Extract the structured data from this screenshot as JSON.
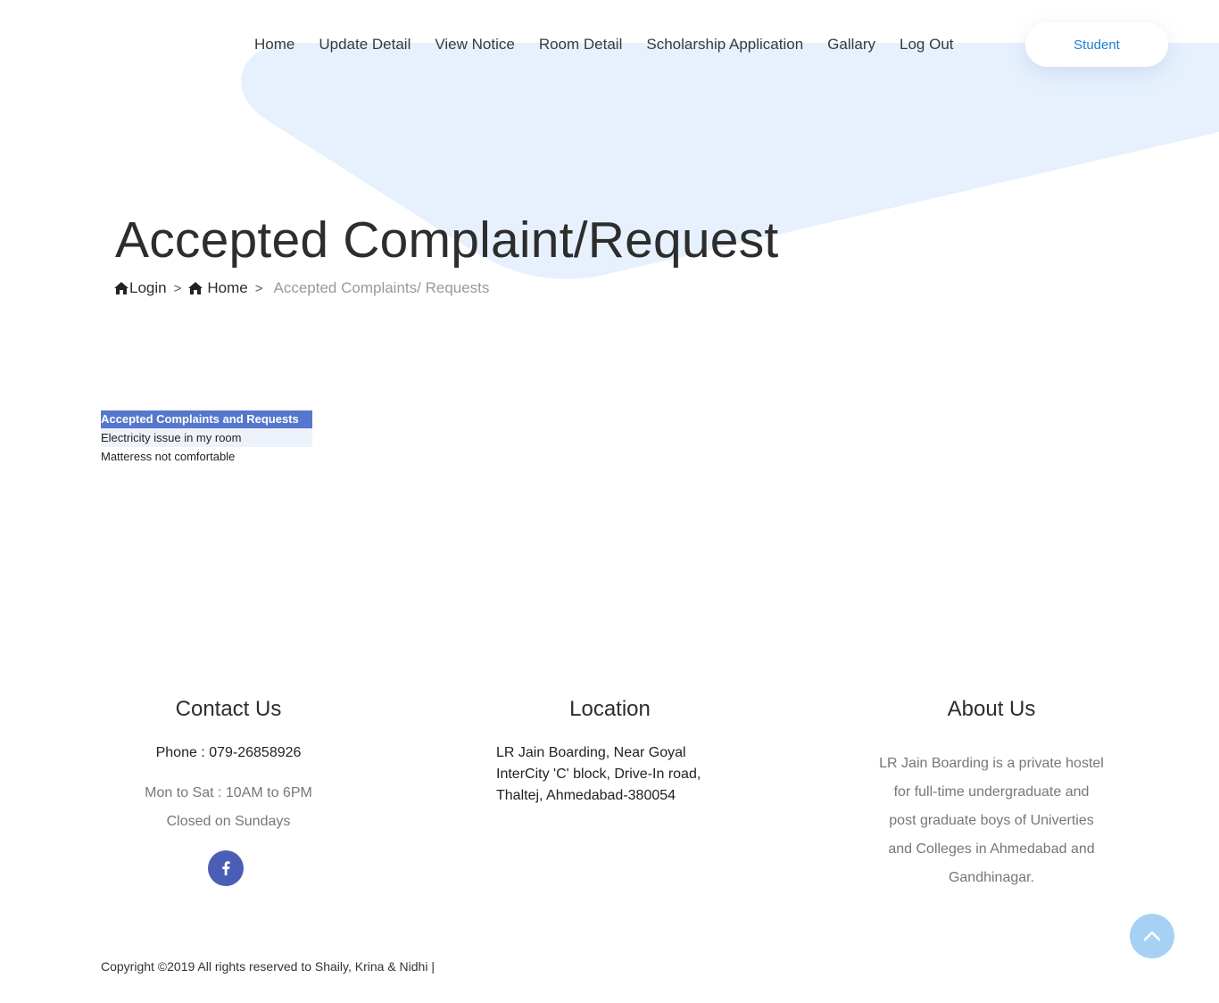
{
  "nav": {
    "items": [
      {
        "label": "Home"
      },
      {
        "label": "Update Detail"
      },
      {
        "label": "View Notice"
      },
      {
        "label": "Room Detail"
      },
      {
        "label": "Scholarship Application"
      },
      {
        "label": "Gallary"
      },
      {
        "label": "Log Out"
      }
    ],
    "student_label": "Student"
  },
  "header": {
    "title": "Accepted Complaint/Request",
    "breadcrumb": {
      "login": "Login",
      "separator": ">",
      "home": "Home",
      "current": "Accepted Complaints/ Requests"
    }
  },
  "complaints": {
    "header": "Accepted Complaints and Requests",
    "rows": [
      "Electricity issue in my room",
      "Matteress not comfortable"
    ]
  },
  "footer": {
    "contact": {
      "title": "Contact Us",
      "phone": "Phone : 079-26858926",
      "hours": "Mon to Sat : 10AM to 6PM",
      "closed": "Closed on Sundays",
      "facebook_icon": "facebook-icon"
    },
    "location": {
      "title": "Location",
      "address": "LR Jain Boarding, Near Goyal InterCity 'C' block, Drive-In road, Thaltej, Ahmedabad-380054"
    },
    "about": {
      "title": "About Us",
      "text": "LR Jain Boarding is a private hostel for full-time undergraduate and post graduate boys of Univerties and Colleges in Ahmedabad and Gandhinagar."
    },
    "copyright": "Copyright ©2019 All rights reserved to Shaily, Krina & Nidhi |"
  },
  "colors": {
    "accent": "#1f7fd6",
    "hero_shape": "#e6f1fd",
    "table_header": "#5577cc",
    "facebook": "#4a5eb5",
    "scroll_top": "#a6d1f5"
  }
}
